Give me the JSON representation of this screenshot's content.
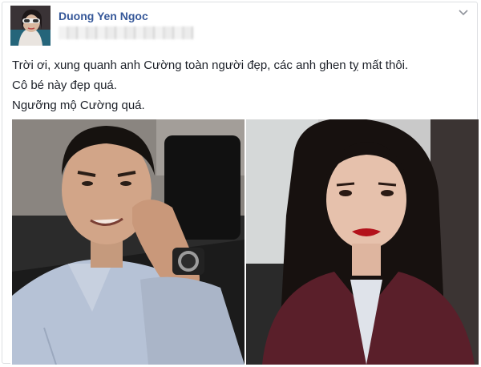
{
  "post": {
    "author_name": "Duong Yen Ngoc",
    "text_lines": [
      "Trời ơi, xung quanh anh Cường toàn người đẹp, các anh ghen tỵ mất thôi.",
      "Cô bé này đẹp quá.",
      "Ngưỡng mộ Cường quá."
    ],
    "options_icon": "chevron-down-icon",
    "avatar_icon": "avatar",
    "colors": {
      "author": "#365899",
      "text": "#1d2129",
      "border": "#dddfe2"
    }
  }
}
